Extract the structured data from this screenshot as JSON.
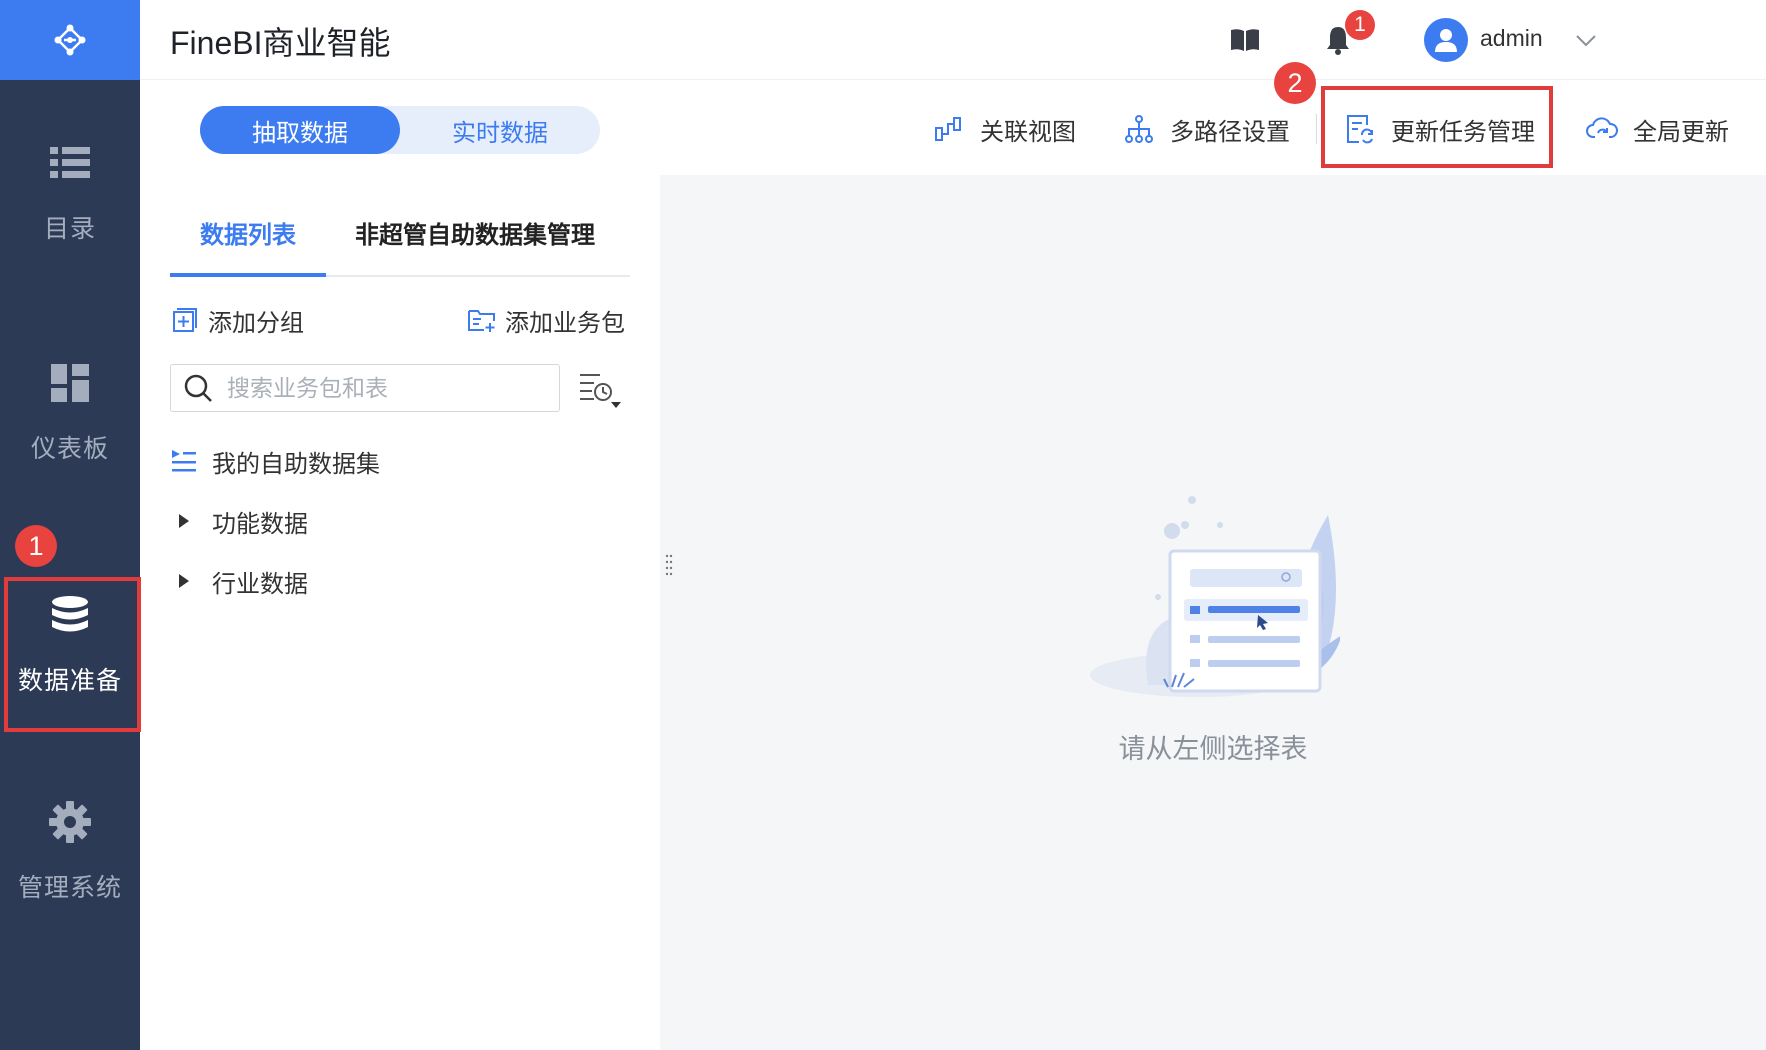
{
  "header": {
    "app_title": "FineBI商业智能",
    "notification_count": "1",
    "username": "admin"
  },
  "sidebar": {
    "items": [
      {
        "label": "目录",
        "icon": "list-icon",
        "active": false
      },
      {
        "label": "仪表板",
        "icon": "dashboard-icon",
        "active": false
      },
      {
        "label": "数据准备",
        "icon": "database-icon",
        "active": true
      },
      {
        "label": "管理系统",
        "icon": "gear-icon",
        "active": false
      }
    ]
  },
  "mode_toggle": {
    "options": [
      "抽取数据",
      "实时数据"
    ],
    "selected": "抽取数据"
  },
  "toolbar": {
    "items": [
      {
        "label": "关联视图",
        "icon": "relation-view-icon"
      },
      {
        "label": "多路径设置",
        "icon": "multipath-icon"
      },
      {
        "label": "更新任务管理",
        "icon": "update-task-icon"
      },
      {
        "label": "全局更新",
        "icon": "cloud-refresh-icon"
      }
    ]
  },
  "left_panel": {
    "tabs": [
      {
        "label": "数据列表",
        "active": true
      },
      {
        "label": "非超管自助数据集管理",
        "active": false
      }
    ],
    "actions": {
      "add_group": "添加分组",
      "add_package": "添加业务包"
    },
    "search": {
      "placeholder": "搜索业务包和表",
      "value": ""
    },
    "tree": [
      {
        "label": "我的自助数据集",
        "icon": "self-service-list-icon"
      },
      {
        "label": "功能数据",
        "icon": "caret-right-icon"
      },
      {
        "label": "行业数据",
        "icon": "caret-right-icon"
      }
    ]
  },
  "content": {
    "empty_text": "请从左侧选择表"
  },
  "annotations": {
    "step1": "1",
    "step2": "2"
  },
  "colors": {
    "accent": "#3d7cf0",
    "sidebar_bg": "#2c3a55",
    "highlight": "#e03c3c",
    "badge": "#e8433e"
  }
}
